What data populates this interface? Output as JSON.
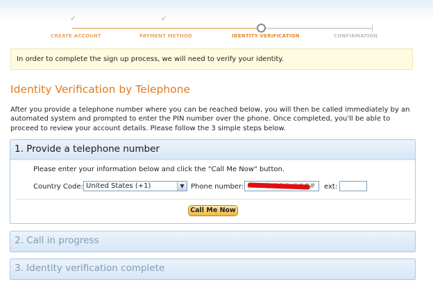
{
  "steps": [
    {
      "label": "CREATE ACCOUNT",
      "state": "done"
    },
    {
      "label": "PAYMENT METHOD",
      "state": "done"
    },
    {
      "label": "IDENTITY VERIFICATION",
      "state": "current"
    },
    {
      "label": "CONFIRMATION",
      "state": "future"
    }
  ],
  "check_glyph": "✓",
  "notice": "In order to complete the sign up process, we will need to verify your identity.",
  "page_title": "Identity Verification by Telephone",
  "intro": "After you provide a telephone number where you can be reached below, you will then be called immediately by an automated system and prompted to enter the PIN number over the phone. Once completed, you'll be able to proceed to review your account details. Please follow the 3 simple steps below.",
  "section1": {
    "title": "1. Provide a telephone number",
    "instructions": "Please enter your information below and click the \"Call Me Now\" button.",
    "country_code_label": "Country Code:",
    "country_code_value": "United States (+1)",
    "phone_label": "Phone number:",
    "phone_value": "(###) ###-####",
    "ext_label": "ext:",
    "ext_value": "",
    "call_button": "Call Me Now"
  },
  "section2": {
    "title": "2. Call in progress"
  },
  "section3": {
    "title": "3. Identity verification complete"
  },
  "colors": {
    "accent": "#e07b1d",
    "section_border": "#a9c8e6",
    "notice_bg": "#fffbe0",
    "button": "#f3b938"
  },
  "icons": [
    "checkmark-icon",
    "current-step-circle-icon",
    "dropdown-arrow-icon"
  ]
}
